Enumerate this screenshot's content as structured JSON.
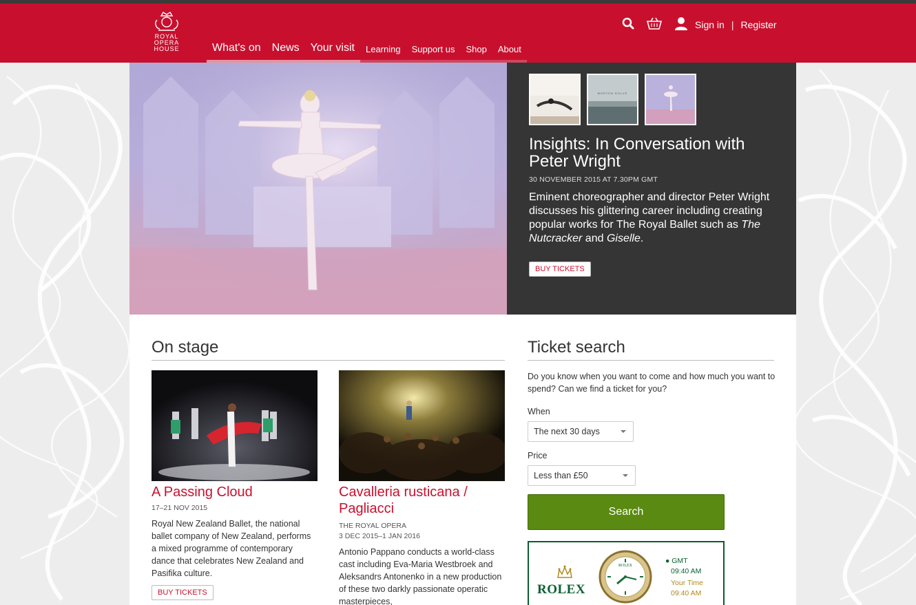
{
  "header": {
    "logo_lines": [
      "ROYAL",
      "OPERA",
      "HOUSE"
    ],
    "nav": [
      {
        "label": "What's on",
        "size": "big"
      },
      {
        "label": "News",
        "size": "big"
      },
      {
        "label": "Your visit",
        "size": "big"
      },
      {
        "label": "Learning",
        "size": "small"
      },
      {
        "label": "Support us",
        "size": "small"
      },
      {
        "label": "Shop",
        "size": "small"
      },
      {
        "label": "About",
        "size": "small"
      }
    ],
    "sign_in": "Sign in",
    "separator": "|",
    "register": "Register",
    "icons": [
      "search-icon",
      "basket-icon",
      "user-icon"
    ]
  },
  "hero": {
    "thumb_caption": "MORTEN ROLVE",
    "title": "Insights: In Conversation with Peter Wright",
    "date": "30 NOVEMBER 2015 AT 7.30PM GMT",
    "desc_lead": "Eminent choreographer and director Peter Wright discusses his glittering career including creating popular works for The Royal Ballet such as ",
    "desc_em1": "The Nutcracker",
    "desc_mid": " and ",
    "desc_em2": "Giselle",
    "desc_end": ".",
    "button": "BUY TICKETS"
  },
  "on_stage": {
    "title": "On stage",
    "cards": [
      {
        "title": "A Passing Cloud",
        "company": "",
        "date": "17–21 NOV 2015",
        "desc": "Royal New Zealand Ballet, the national ballet company of New Zealand, performs a mixed programme of contemporary dance that celebrates New Zealand and Pasifika culture.",
        "button": "BUY TICKETS"
      },
      {
        "title": "Cavalleria rusticana / Pagliacci",
        "company": "THE ROYAL OPERA",
        "date": "3 DEC 2015–1 JAN 2016",
        "desc": "Antonio Pappano conducts a world-class cast including Eva-Maria Westbroek and Aleksandrs Antonenko in a new production of these two darkly passionate operatic masterpieces,"
      }
    ]
  },
  "ticket_search": {
    "title": "Ticket search",
    "intro": "Do you know when you want to come and how much you want to spend? Can we find a ticket for you?",
    "when_label": "When",
    "when_value": "The next 30 days",
    "price_label": "Price",
    "price_value": "Less than £50",
    "search_button": "Search"
  },
  "rolex": {
    "brand": "ROLEX",
    "dial_brand": "ROLEX",
    "gmt_label": "GMT",
    "gmt_time": "09:40 AM",
    "your_time_label": "Your Time",
    "your_time": "09:40 AM"
  },
  "colors": {
    "brand_red": "#c8102e",
    "hero_panel": "#353535",
    "search_green": "#5a8a12",
    "rolex_green": "#0a6131"
  }
}
